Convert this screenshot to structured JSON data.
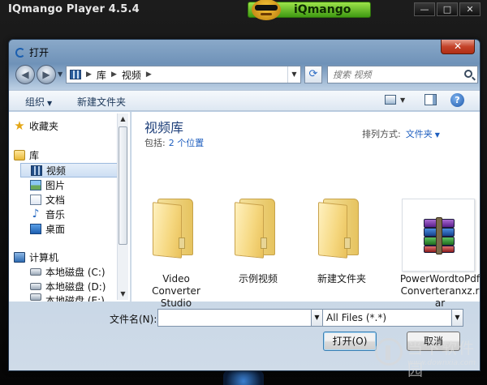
{
  "player": {
    "title": "IQmango Player 4.5.4",
    "brand": "iQmango",
    "window_buttons": [
      "—",
      "□",
      "✕"
    ]
  },
  "dialog": {
    "title": "打开",
    "close": "✕",
    "breadcrumb": [
      "库",
      "视频"
    ],
    "search_placeholder": "搜索 视频",
    "toolbar": {
      "organize": "组织",
      "new_folder": "新建文件夹"
    }
  },
  "navpane": {
    "items": [
      {
        "label": "收藏夹",
        "icon": "star-icon"
      },
      {
        "label": "库",
        "icon": "library-icon"
      },
      {
        "label": "视频",
        "icon": "video-icon",
        "selected": true
      },
      {
        "label": "图片",
        "icon": "picture-icon"
      },
      {
        "label": "文档",
        "icon": "document-icon"
      },
      {
        "label": "音乐",
        "icon": "music-icon"
      },
      {
        "label": "桌面",
        "icon": "desktop-icon"
      },
      {
        "label": "计算机",
        "icon": "computer-icon"
      },
      {
        "label": "本地磁盘 (C:)",
        "icon": "drive-icon"
      },
      {
        "label": "本地磁盘 (D:)",
        "icon": "drive-icon"
      },
      {
        "label": "本地磁盘 (E:)",
        "icon": "drive-icon"
      }
    ]
  },
  "content": {
    "library_title": "视频库",
    "includes_label": "包括:",
    "includes_link": "2 个位置",
    "arrange_label": "排列方式:",
    "arrange_value": "文件夹",
    "items": [
      {
        "label": "Video Converter Studio",
        "type": "folder"
      },
      {
        "label": "示例视频",
        "type": "folder"
      },
      {
        "label": "新建文件夹",
        "type": "folder"
      },
      {
        "label": "PowerWordtoPdfConverteranxz.rar",
        "type": "rar"
      }
    ]
  },
  "footer": {
    "filename_label": "文件名(N):",
    "filename_value": "",
    "filetype_value": "All Files (*.*)",
    "open_button": "打开(O)",
    "cancel_button": "取消"
  },
  "watermark": {
    "text": "当下软件园",
    "url": "www.downxia.com"
  }
}
